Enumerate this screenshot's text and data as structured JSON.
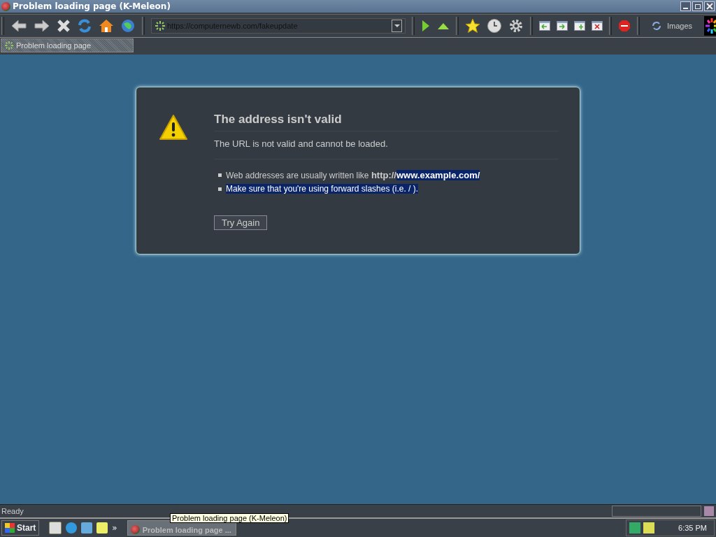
{
  "window": {
    "title": "Problem loading page (K-Meleon)"
  },
  "address_bar": {
    "value": "https://computernewb.com/fakeupdate"
  },
  "images_button": {
    "label": "Images"
  },
  "tabs": [
    {
      "label": "Problem loading page",
      "selected": true
    }
  ],
  "error_page": {
    "title": "The address isn't valid",
    "description": "The URL is not valid and cannot be loaded.",
    "bullets": [
      [
        {
          "text": "Web addresses are usually written like ",
          "bold": false,
          "highlighted": false
        },
        {
          "text": "http://",
          "bold": true,
          "highlighted": false
        },
        {
          "text": "www.example.com/",
          "bold": true,
          "highlighted": true
        }
      ],
      [
        {
          "text": "Make sure that you're using forward slashes (i.e. / ).",
          "bold": false,
          "highlighted": true
        }
      ]
    ],
    "button": "Try Again"
  },
  "status_bar": {
    "text": "Ready"
  },
  "taskbar": {
    "start": "Start",
    "chevron": "»",
    "task": {
      "label": "Problem loading page ...",
      "selected": true
    },
    "tooltip": "Problem loading page (K-Meleon)",
    "clock": "6:35 PM"
  }
}
